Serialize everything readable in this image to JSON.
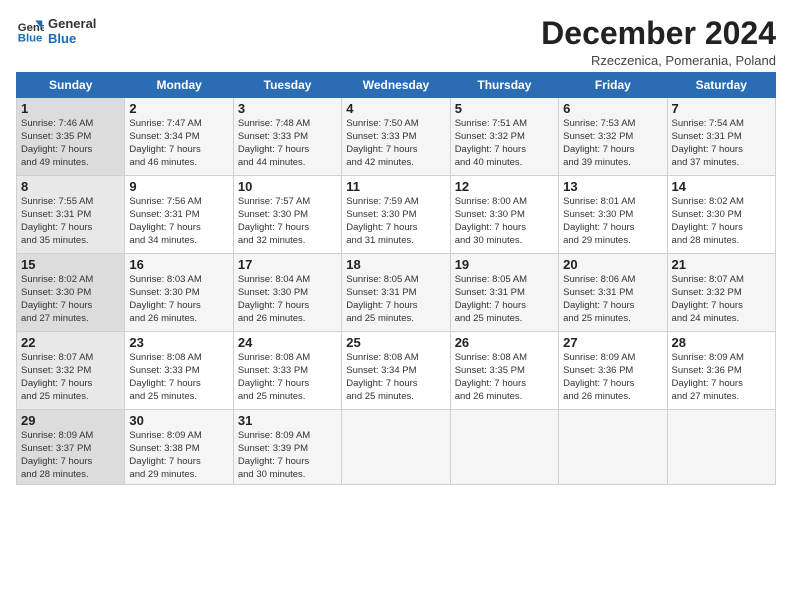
{
  "logo": {
    "line1": "General",
    "line2": "Blue"
  },
  "title": "December 2024",
  "subtitle": "Rzeczenica, Pomerania, Poland",
  "days_header": [
    "Sunday",
    "Monday",
    "Tuesday",
    "Wednesday",
    "Thursday",
    "Friday",
    "Saturday"
  ],
  "weeks": [
    [
      {
        "day": "1",
        "detail": "Sunrise: 7:46 AM\nSunset: 3:35 PM\nDaylight: 7 hours\nand 49 minutes."
      },
      {
        "day": "2",
        "detail": "Sunrise: 7:47 AM\nSunset: 3:34 PM\nDaylight: 7 hours\nand 46 minutes."
      },
      {
        "day": "3",
        "detail": "Sunrise: 7:48 AM\nSunset: 3:33 PM\nDaylight: 7 hours\nand 44 minutes."
      },
      {
        "day": "4",
        "detail": "Sunrise: 7:50 AM\nSunset: 3:33 PM\nDaylight: 7 hours\nand 42 minutes."
      },
      {
        "day": "5",
        "detail": "Sunrise: 7:51 AM\nSunset: 3:32 PM\nDaylight: 7 hours\nand 40 minutes."
      },
      {
        "day": "6",
        "detail": "Sunrise: 7:53 AM\nSunset: 3:32 PM\nDaylight: 7 hours\nand 39 minutes."
      },
      {
        "day": "7",
        "detail": "Sunrise: 7:54 AM\nSunset: 3:31 PM\nDaylight: 7 hours\nand 37 minutes."
      }
    ],
    [
      {
        "day": "8",
        "detail": "Sunrise: 7:55 AM\nSunset: 3:31 PM\nDaylight: 7 hours\nand 35 minutes."
      },
      {
        "day": "9",
        "detail": "Sunrise: 7:56 AM\nSunset: 3:31 PM\nDaylight: 7 hours\nand 34 minutes."
      },
      {
        "day": "10",
        "detail": "Sunrise: 7:57 AM\nSunset: 3:30 PM\nDaylight: 7 hours\nand 32 minutes."
      },
      {
        "day": "11",
        "detail": "Sunrise: 7:59 AM\nSunset: 3:30 PM\nDaylight: 7 hours\nand 31 minutes."
      },
      {
        "day": "12",
        "detail": "Sunrise: 8:00 AM\nSunset: 3:30 PM\nDaylight: 7 hours\nand 30 minutes."
      },
      {
        "day": "13",
        "detail": "Sunrise: 8:01 AM\nSunset: 3:30 PM\nDaylight: 7 hours\nand 29 minutes."
      },
      {
        "day": "14",
        "detail": "Sunrise: 8:02 AM\nSunset: 3:30 PM\nDaylight: 7 hours\nand 28 minutes."
      }
    ],
    [
      {
        "day": "15",
        "detail": "Sunrise: 8:02 AM\nSunset: 3:30 PM\nDaylight: 7 hours\nand 27 minutes."
      },
      {
        "day": "16",
        "detail": "Sunrise: 8:03 AM\nSunset: 3:30 PM\nDaylight: 7 hours\nand 26 minutes."
      },
      {
        "day": "17",
        "detail": "Sunrise: 8:04 AM\nSunset: 3:30 PM\nDaylight: 7 hours\nand 26 minutes."
      },
      {
        "day": "18",
        "detail": "Sunrise: 8:05 AM\nSunset: 3:31 PM\nDaylight: 7 hours\nand 25 minutes."
      },
      {
        "day": "19",
        "detail": "Sunrise: 8:05 AM\nSunset: 3:31 PM\nDaylight: 7 hours\nand 25 minutes."
      },
      {
        "day": "20",
        "detail": "Sunrise: 8:06 AM\nSunset: 3:31 PM\nDaylight: 7 hours\nand 25 minutes."
      },
      {
        "day": "21",
        "detail": "Sunrise: 8:07 AM\nSunset: 3:32 PM\nDaylight: 7 hours\nand 24 minutes."
      }
    ],
    [
      {
        "day": "22",
        "detail": "Sunrise: 8:07 AM\nSunset: 3:32 PM\nDaylight: 7 hours\nand 25 minutes."
      },
      {
        "day": "23",
        "detail": "Sunrise: 8:08 AM\nSunset: 3:33 PM\nDaylight: 7 hours\nand 25 minutes."
      },
      {
        "day": "24",
        "detail": "Sunrise: 8:08 AM\nSunset: 3:33 PM\nDaylight: 7 hours\nand 25 minutes."
      },
      {
        "day": "25",
        "detail": "Sunrise: 8:08 AM\nSunset: 3:34 PM\nDaylight: 7 hours\nand 25 minutes."
      },
      {
        "day": "26",
        "detail": "Sunrise: 8:08 AM\nSunset: 3:35 PM\nDaylight: 7 hours\nand 26 minutes."
      },
      {
        "day": "27",
        "detail": "Sunrise: 8:09 AM\nSunset: 3:36 PM\nDaylight: 7 hours\nand 26 minutes."
      },
      {
        "day": "28",
        "detail": "Sunrise: 8:09 AM\nSunset: 3:36 PM\nDaylight: 7 hours\nand 27 minutes."
      }
    ],
    [
      {
        "day": "29",
        "detail": "Sunrise: 8:09 AM\nSunset: 3:37 PM\nDaylight: 7 hours\nand 28 minutes."
      },
      {
        "day": "30",
        "detail": "Sunrise: 8:09 AM\nSunset: 3:38 PM\nDaylight: 7 hours\nand 29 minutes."
      },
      {
        "day": "31",
        "detail": "Sunrise: 8:09 AM\nSunset: 3:39 PM\nDaylight: 7 hours\nand 30 minutes."
      },
      {
        "day": "",
        "detail": ""
      },
      {
        "day": "",
        "detail": ""
      },
      {
        "day": "",
        "detail": ""
      },
      {
        "day": "",
        "detail": ""
      }
    ]
  ]
}
